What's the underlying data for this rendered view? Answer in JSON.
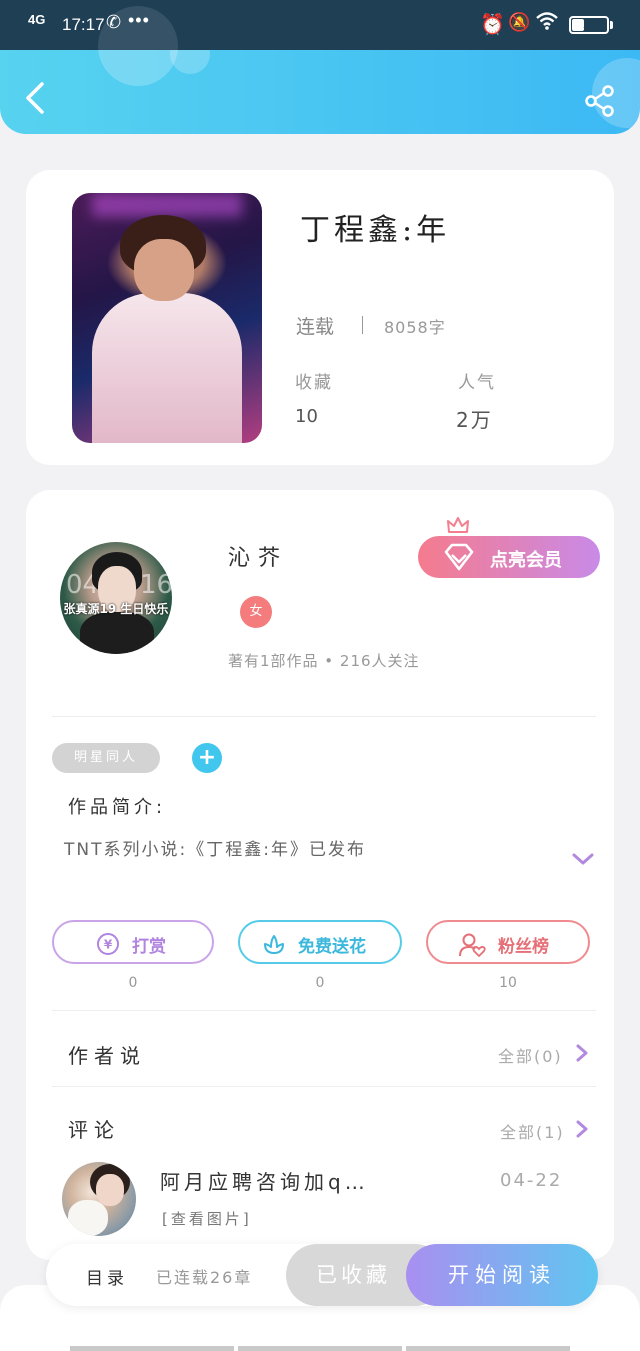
{
  "status_bar": {
    "network": "4G",
    "time": "17:17",
    "call_icon": "phone-call-icon",
    "more": "•••",
    "battery": "17"
  },
  "header": {
    "back_icon": "chevron-left-icon",
    "share_icon": "share-icon",
    "color_start": "#57d3f0",
    "color_end": "#3cb8f4"
  },
  "book": {
    "title": "丁程鑫:年",
    "status": "连载",
    "word_count": "8058字",
    "favorites_label": "收藏",
    "favorites_value": "10",
    "popularity_label": "人气",
    "popularity_value": "2万"
  },
  "author": {
    "name": "沁芥",
    "gender_badge": "女",
    "stats": "著有1部作品 • 216人关注",
    "avatar_text": "张真源19 生日快乐",
    "avatar_numbers": [
      "04",
      "16"
    ],
    "vip_button": "点亮会员",
    "tag": "明星同人",
    "intro_title": "作品简介:",
    "intro_text": "TNT系列小说:《丁程鑫:年》已发布"
  },
  "actions": [
    {
      "label": "打赏",
      "count": "0",
      "icon": "yen-coin-icon",
      "color": "#b184e0"
    },
    {
      "label": "免费送花",
      "count": "0",
      "icon": "flower-icon",
      "color": "#3bb8dc"
    },
    {
      "label": "粉丝榜",
      "count": "10",
      "icon": "fan-heart-icon",
      "color": "#e57077"
    }
  ],
  "author_says": {
    "title": "作者说",
    "all": "全部(0)"
  },
  "comments": {
    "title": "评论",
    "all": "全部(1)",
    "items": [
      {
        "text": "阿月应聘咨询加q…",
        "image_link": "[查看图片]",
        "date": "04-22"
      }
    ]
  },
  "bottom_bar": {
    "toc": "目录",
    "serial": "已连载26章",
    "collected": "已收藏",
    "read": "开始阅读"
  }
}
